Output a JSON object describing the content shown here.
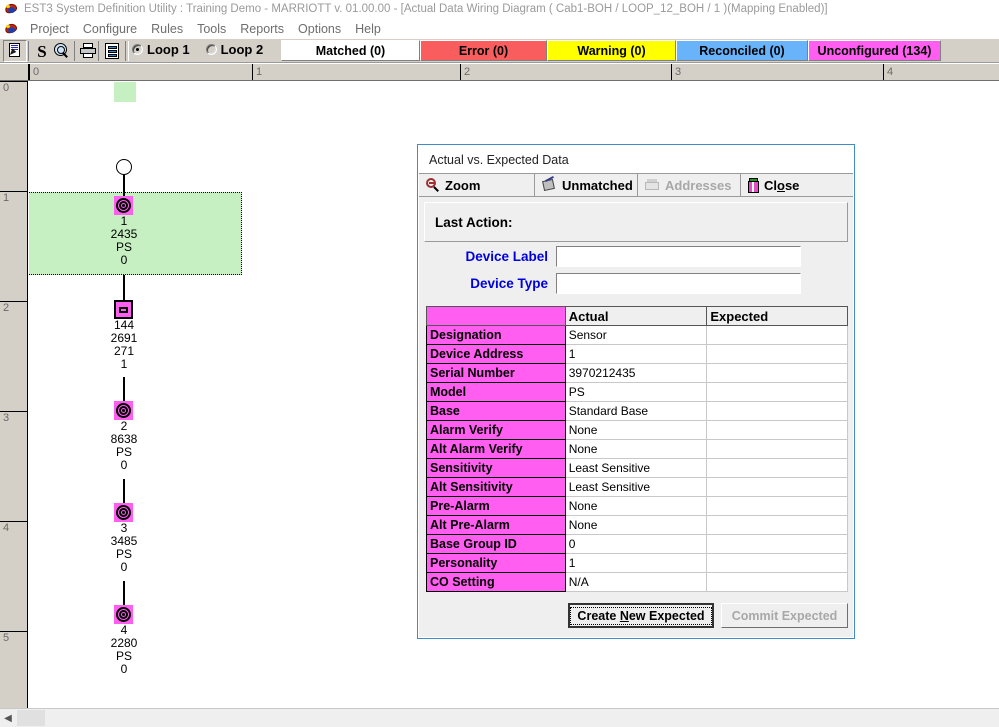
{
  "window": {
    "title": "EST3 System Definition Utility : Training Demo - MARRIOTT v. 01.00.00 - [Actual Data Wiring Diagram ( Cab1-BOH / LOOP_12_BOH / 1 )(Mapping Enabled)]"
  },
  "menu": {
    "items": [
      "Project",
      "Configure",
      "Rules",
      "Tools",
      "Reports",
      "Options",
      "Help"
    ]
  },
  "toolbar": {
    "buttons": [
      {
        "name": "select-tool",
        "icon": "document-pointer-icon"
      },
      {
        "name": "serial-tool",
        "icon": "dollar-s-icon"
      },
      {
        "name": "zoom-tool",
        "icon": "magnifier-globe-icon"
      },
      {
        "name": "print-tool",
        "icon": "printer-icon"
      },
      {
        "name": "report-tool",
        "icon": "report-list-icon"
      }
    ],
    "loops": [
      {
        "label": "Loop 1",
        "selected": true
      },
      {
        "label": "Loop 2",
        "selected": false
      }
    ],
    "status_tabs": [
      {
        "label": "Matched (0)",
        "color": "#ffffff"
      },
      {
        "label": "Error (0)",
        "color": "#fa5d5d"
      },
      {
        "label": "Warning (0)",
        "color": "#ffff00"
      },
      {
        "label": "Reconciled (0)",
        "color": "#68b3fa"
      },
      {
        "label": "Unconfigured (134)",
        "color": "#ff5ef0"
      }
    ]
  },
  "rulers": {
    "horizontal_ticks": [
      "0",
      "1",
      "2",
      "3",
      "4"
    ],
    "vertical_ticks": [
      "0",
      "1",
      "2",
      "3",
      "4",
      "5"
    ]
  },
  "diagram": {
    "nodes": [
      {
        "index": "1",
        "type": "circle-terminator",
        "label": ""
      },
      {
        "index": "1",
        "type": "sensor",
        "label": "1\n2435\nPS\n0",
        "selected": true
      },
      {
        "index": "2",
        "type": "module",
        "label": "144\n2691\n271\n1",
        "selected": false
      },
      {
        "index": "3",
        "type": "sensor",
        "label": "2\n8638\nPS\n0",
        "selected": false
      },
      {
        "index": "4",
        "type": "sensor",
        "label": "3\n3485\nPS\n0",
        "selected": false
      },
      {
        "index": "5",
        "type": "sensor",
        "label": "4\n2280\nPS\n0",
        "selected": false
      }
    ],
    "selection_color": "#c6f0c2"
  },
  "dialog": {
    "title": "Actual vs. Expected Data",
    "toolbar": [
      {
        "label": "Zoom",
        "icon": "magnifier-icon",
        "enabled": true
      },
      {
        "label": "Unmatched",
        "icon": "unmatched-icon",
        "enabled": true
      },
      {
        "label": "Addresses",
        "icon": "addresses-icon",
        "enabled": false
      },
      {
        "label": "Close",
        "icon": "door-close-icon",
        "enabled": true,
        "accel": "o"
      }
    ],
    "last_action_label": "Last Action:",
    "last_action_value": "",
    "fields": [
      {
        "label": "Device Label",
        "value": "",
        "placeholder": ""
      },
      {
        "label": "Device Type",
        "value": "",
        "placeholder": ""
      }
    ],
    "table": {
      "headers": [
        "",
        "Actual",
        "Expected"
      ],
      "rows": [
        {
          "key": "Designation",
          "actual": "Sensor",
          "expected": ""
        },
        {
          "key": "Device Address",
          "actual": "1",
          "expected": ""
        },
        {
          "key": "Serial Number",
          "actual": "3970212435",
          "expected": ""
        },
        {
          "key": "Model",
          "actual": "PS",
          "expected": ""
        },
        {
          "key": "Base",
          "actual": "Standard Base",
          "expected": ""
        },
        {
          "key": "Alarm Verify",
          "actual": "None",
          "expected": ""
        },
        {
          "key": "Alt Alarm Verify",
          "actual": "None",
          "expected": ""
        },
        {
          "key": "Sensitivity",
          "actual": "Least Sensitive",
          "expected": ""
        },
        {
          "key": "Alt Sensitivity",
          "actual": "Least Sensitive",
          "expected": ""
        },
        {
          "key": "Pre-Alarm",
          "actual": "None",
          "expected": ""
        },
        {
          "key": "Alt Pre-Alarm",
          "actual": "None",
          "expected": ""
        },
        {
          "key": "Base Group ID",
          "actual": "0",
          "expected": ""
        },
        {
          "key": "Personality",
          "actual": "1",
          "expected": ""
        },
        {
          "key": "CO Setting",
          "actual": "N/A",
          "expected": ""
        }
      ]
    },
    "footer": {
      "create_label_pre": "Create ",
      "create_accel": "N",
      "create_label_post": "ew Expected",
      "create_full": "Create New Expected",
      "commit_label": "Commit Expected",
      "commit_enabled": false
    }
  },
  "colors": {
    "magenta": "#ff5ef0",
    "green_select": "#c6f0c2",
    "dialog_border": "#3f8ccc",
    "label_blue": "#0000dd"
  }
}
